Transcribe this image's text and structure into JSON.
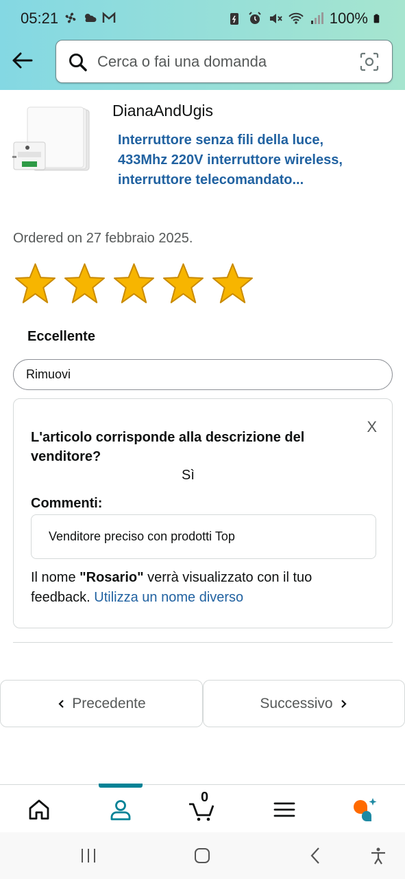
{
  "status_bar": {
    "time": "05:21",
    "battery": "100%"
  },
  "search": {
    "placeholder": "Cerca o fai una domanda"
  },
  "product": {
    "seller": "DianaAndUgis",
    "title": "Interruttore senza fili della luce, 433Mhz 220V interruttore wireless, interruttore telecomandato..."
  },
  "order": {
    "date_text": "Ordered on 27 febbraio 2025."
  },
  "rating": {
    "value": 5,
    "max": 5,
    "label": "Eccellente"
  },
  "remove_button": {
    "label": "Rimuovi"
  },
  "feedback_card": {
    "close": "X",
    "question": "L'articolo corrisponde alla descrizione del venditore?",
    "answer": "Sì",
    "comments_label": "Commenti:",
    "comment_value": "Venditore preciso con prodotti Top",
    "name_prefix": "Il nome ",
    "name": "\"Rosario\"",
    "name_suffix": " verrà visualizzato con il tuo feedback. ",
    "name_link": "Utilizza un nome diverso"
  },
  "pager": {
    "prev_label": "Precedente",
    "next_label": "Successivo"
  },
  "bottom_nav": {
    "cart_count": "0",
    "active": "account"
  },
  "colors": {
    "accent": "#008296",
    "link": "#2162a1",
    "star": "#f7b500"
  }
}
